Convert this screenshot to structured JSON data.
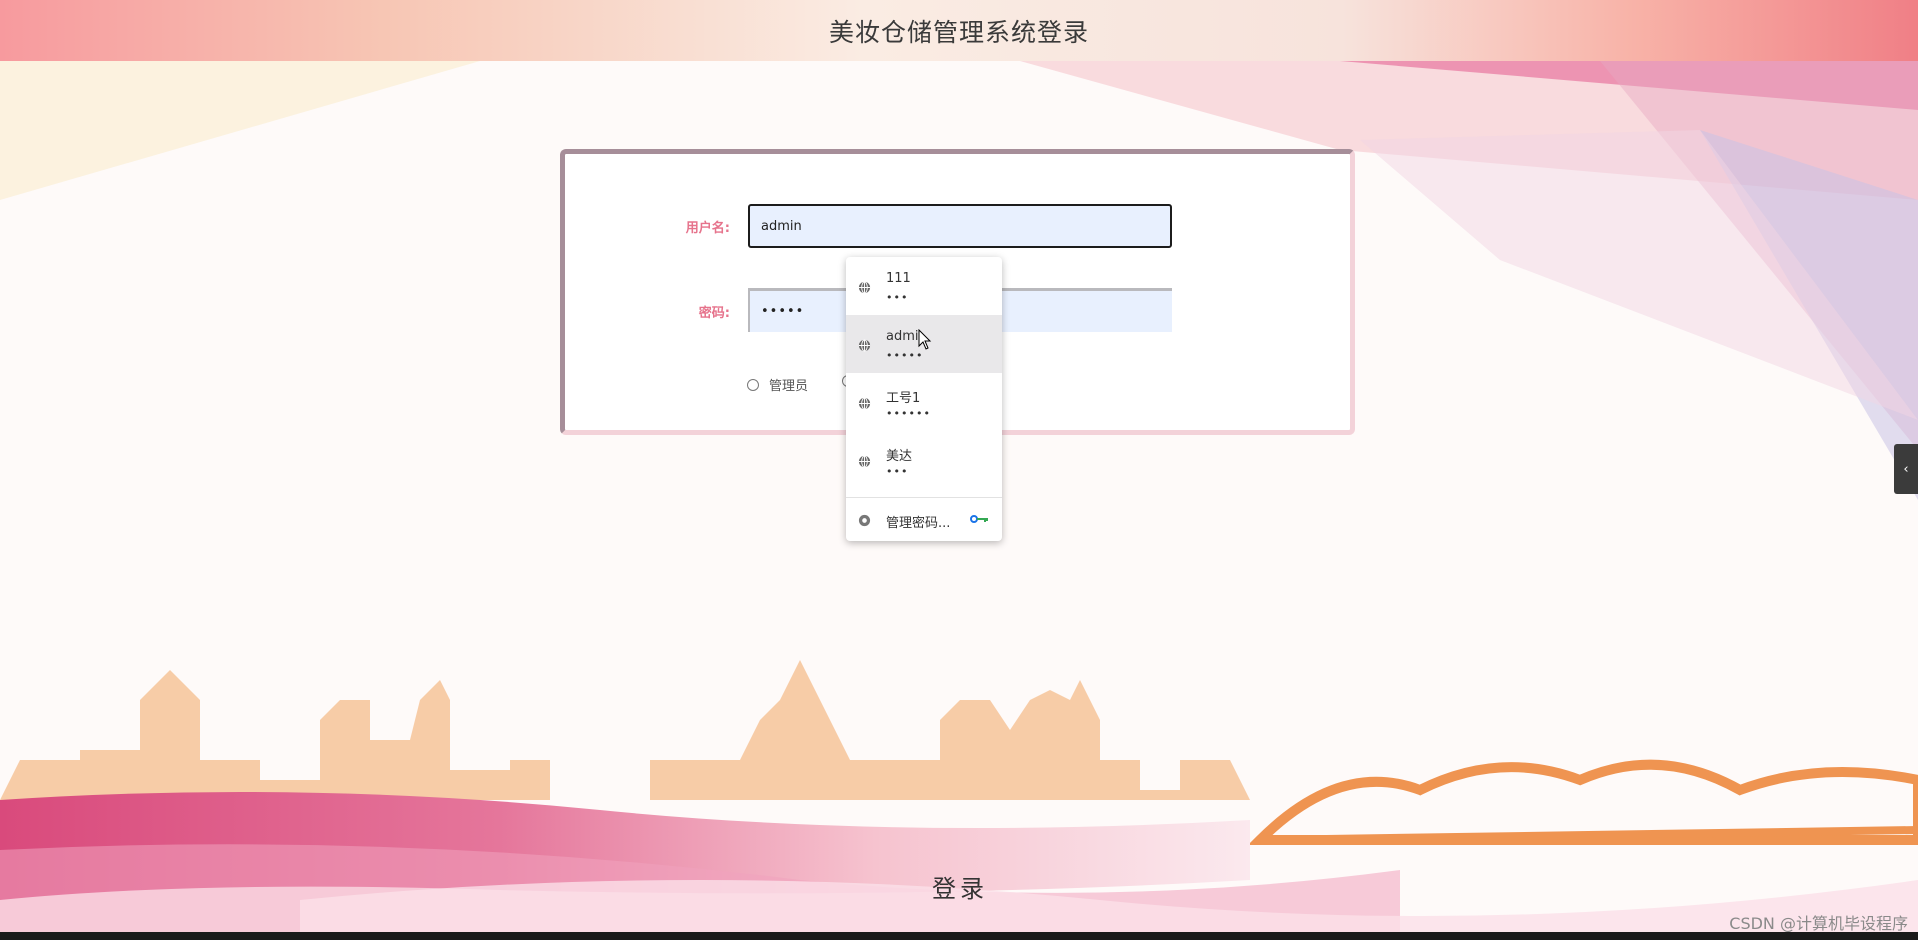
{
  "page": {
    "title": "美妆仓储管理系统登录",
    "login_button": "登录",
    "watermark": "CSDN @计算机毕设程序"
  },
  "form": {
    "username_label": "用户名:",
    "username_value": "admin",
    "password_label": "密码:",
    "password_value": "•••••",
    "roles": [
      "管理员"
    ]
  },
  "autofill": {
    "items": [
      {
        "name": "111",
        "masked": "•••",
        "icon": "globe-icon"
      },
      {
        "name": "admi",
        "masked": "•••••",
        "icon": "globe-icon",
        "highlighted": true
      },
      {
        "name": "工号1",
        "masked": "••••••",
        "icon": "globe-icon"
      },
      {
        "name": "美达",
        "masked": "•••",
        "icon": "globe-icon"
      }
    ],
    "manage_label": "管理密码...",
    "manage_icon": "chrome-icon",
    "key_icon": "key-icon"
  },
  "colors": {
    "label": "#e6738c",
    "card_border": "#a68e99",
    "input_bg": "#e8f0fe"
  }
}
